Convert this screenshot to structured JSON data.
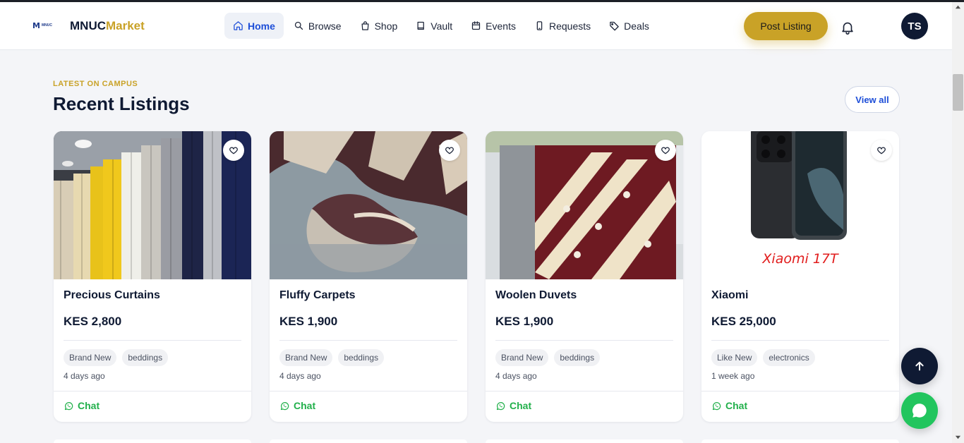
{
  "header": {
    "logo_mark": "M",
    "logo_text": "MNUC",
    "brand_part1": "MNUC",
    "brand_part2": "Market",
    "nav": [
      {
        "label": "Home",
        "icon": "home-icon",
        "active": true
      },
      {
        "label": "Browse",
        "icon": "search-icon",
        "active": false
      },
      {
        "label": "Shop",
        "icon": "shopping-bag-icon",
        "active": false
      },
      {
        "label": "Vault",
        "icon": "book-icon",
        "active": false
      },
      {
        "label": "Events",
        "icon": "calendar-icon",
        "active": false
      },
      {
        "label": "Requests",
        "icon": "phone-icon",
        "active": false
      },
      {
        "label": "Deals",
        "icon": "tag-icon",
        "active": false
      }
    ],
    "post_listing": "Post Listing",
    "avatar_initials": "TS"
  },
  "section": {
    "eyebrow": "LATEST ON CAMPUS",
    "title": "Recent Listings",
    "view_all": "View all"
  },
  "listings": [
    {
      "title": "Precious Curtains",
      "price": "KES 2,800",
      "condition": "Brand New",
      "category": "beddings",
      "time": "4 days ago",
      "chat": "Chat"
    },
    {
      "title": "Fluffy Carpets",
      "price": "KES 1,900",
      "condition": "Brand New",
      "category": "beddings",
      "time": "4 days ago",
      "chat": "Chat"
    },
    {
      "title": "Woolen Duvets",
      "price": "KES 1,900",
      "condition": "Brand New",
      "category": "beddings",
      "time": "4 days ago",
      "chat": "Chat"
    },
    {
      "title": "Xiaomi",
      "price": "KES 25,000",
      "condition": "Like New",
      "category": "electronics",
      "time": "1 week ago",
      "chat": "Chat",
      "image_caption": "Xiaomi 17T"
    }
  ],
  "colors": {
    "accent_gold": "#c9a227",
    "navy": "#0f1a33",
    "link_blue": "#1d4ed8",
    "chat_green": "#22b04b"
  }
}
